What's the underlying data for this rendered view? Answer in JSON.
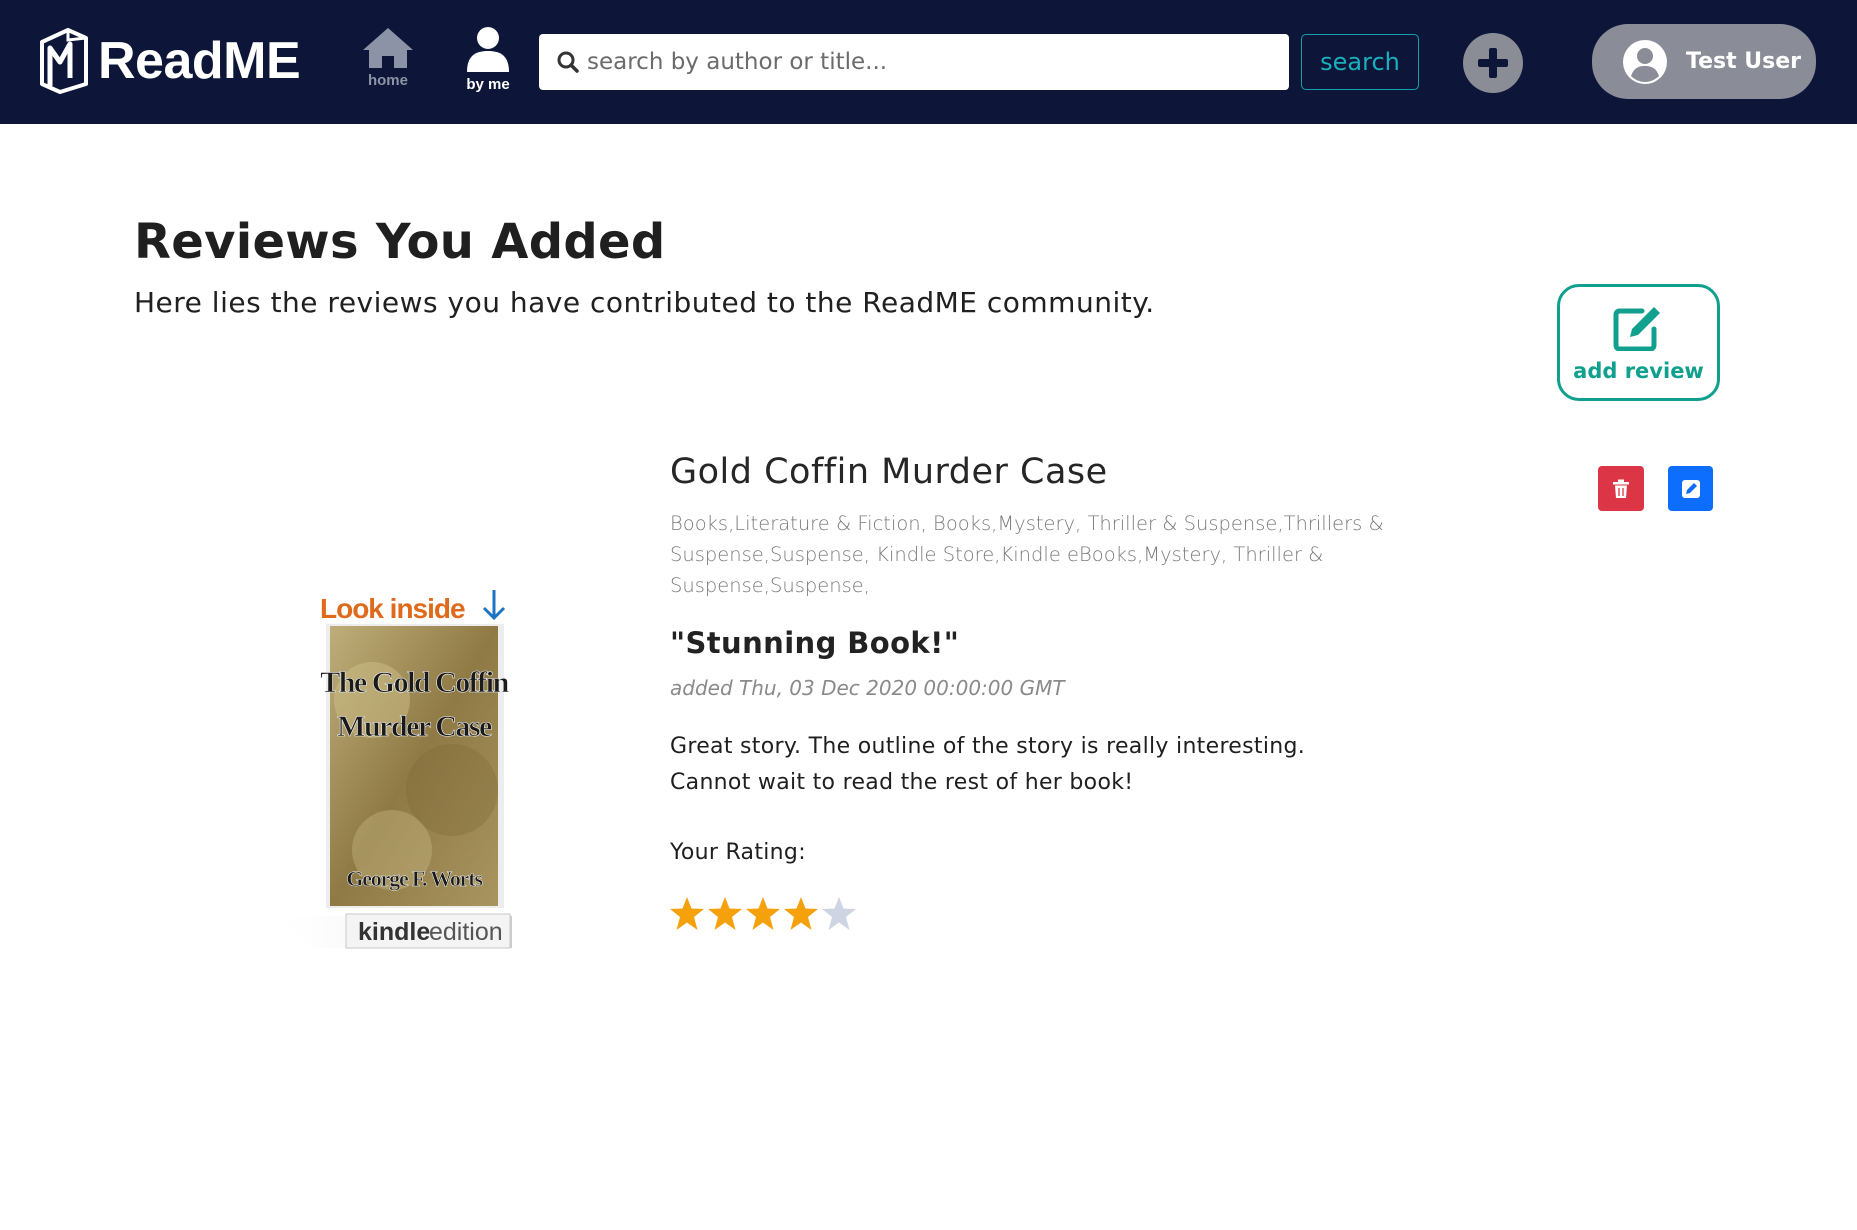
{
  "app": {
    "name": "ReadME"
  },
  "nav": {
    "home_label": "home",
    "byme_label": "by me",
    "search_placeholder": "search by author or title...",
    "search_button": "search",
    "user_name": "Test User"
  },
  "page": {
    "title": "Reviews You Added",
    "subtitle": "Here lies the reviews you have contributed to the ReadME community.",
    "add_review_label": "add review"
  },
  "review": {
    "book_title": "Gold Coffin Murder Case",
    "categories": "Books,Literature & Fiction, Books,Mystery, Thriller & Suspense,Thrillers & Suspense,Suspense, Kindle Store,Kindle eBooks,Mystery, Thriller & Suspense,Suspense,",
    "cover": {
      "look_inside": "Look inside",
      "title_line1": "The Gold Coffin",
      "title_line2": "Murder Case",
      "author": "George F. Worts",
      "edition_brand": "kindle",
      "edition_word": "edition"
    },
    "review_title": "\"Stunning Book!\"",
    "date_added": "added Thu, 03 Dec 2020 00:00:00 GMT",
    "body": "Great story. The outline of the story is really interesting. Cannot wait to read the rest of her book!",
    "rating_label": "Your Rating:",
    "rating": 4,
    "rating_max": 5
  },
  "colors": {
    "navbar": "#0d1638",
    "accent_teal": "#12a08e",
    "search_teal": "#19b0bf",
    "star_filled": "#f5a10b",
    "star_empty": "#cfd4e3",
    "delete": "#dc3545",
    "edit": "#0d6efd"
  },
  "icons": {
    "logo": "book-logo-icon",
    "home": "home-icon",
    "byme": "user-icon",
    "search": "search-icon",
    "plus": "plus-circle-icon",
    "avatar": "user-circle-icon",
    "add_review": "pen-square-icon",
    "delete": "trash-icon",
    "edit": "edit-icon",
    "star": "star-icon"
  }
}
